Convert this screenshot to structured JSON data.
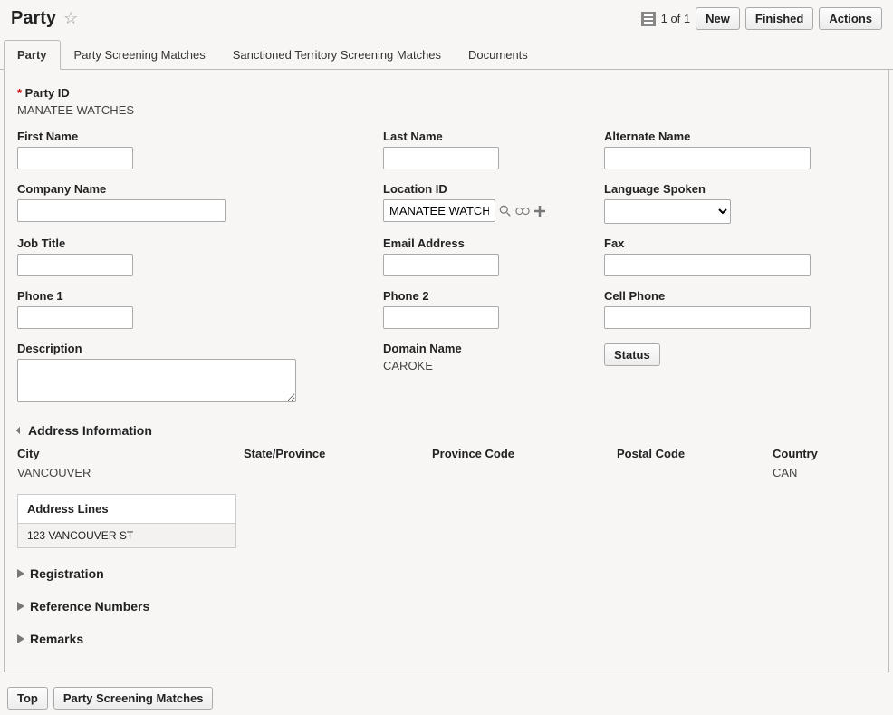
{
  "header": {
    "title": "Party",
    "counter": "1 of 1",
    "buttons": {
      "new": "New",
      "finished": "Finished",
      "actions": "Actions"
    }
  },
  "tabs": [
    {
      "label": "Party"
    },
    {
      "label": "Party Screening Matches"
    },
    {
      "label": "Sanctioned Territory Screening Matches"
    },
    {
      "label": "Documents"
    }
  ],
  "party": {
    "party_id_label": "Party ID",
    "party_id_value": "MANATEE WATCHES",
    "first_name_label": "First Name",
    "first_name_value": "",
    "last_name_label": "Last Name",
    "last_name_value": "",
    "alternate_name_label": "Alternate Name",
    "alternate_name_value": "",
    "company_name_label": "Company Name",
    "company_name_value": "",
    "location_id_label": "Location ID",
    "location_id_value": "MANATEE WATCHES",
    "language_spoken_label": "Language Spoken",
    "language_spoken_value": "",
    "job_title_label": "Job Title",
    "job_title_value": "",
    "email_label": "Email Address",
    "email_value": "",
    "fax_label": "Fax",
    "fax_value": "",
    "phone1_label": "Phone 1",
    "phone1_value": "",
    "phone2_label": "Phone 2",
    "phone2_value": "",
    "cell_label": "Cell Phone",
    "cell_value": "",
    "description_label": "Description",
    "description_value": "",
    "domain_name_label": "Domain Name",
    "domain_name_value": "CAROKE",
    "status_button": "Status"
  },
  "sections": {
    "address_info": "Address Information",
    "registration": "Registration",
    "reference_numbers": "Reference Numbers",
    "remarks": "Remarks"
  },
  "address": {
    "city_label": "City",
    "city_value": "VANCOUVER",
    "state_label": "State/Province",
    "state_value": "",
    "province_code_label": "Province Code",
    "province_code_value": "",
    "postal_label": "Postal Code",
    "postal_value": "",
    "country_label": "Country",
    "country_value": "CAN",
    "address_lines_header": "Address Lines",
    "address_lines": [
      "123 VANCOUVER ST"
    ]
  },
  "footer": {
    "top": "Top",
    "psm": "Party Screening Matches"
  }
}
